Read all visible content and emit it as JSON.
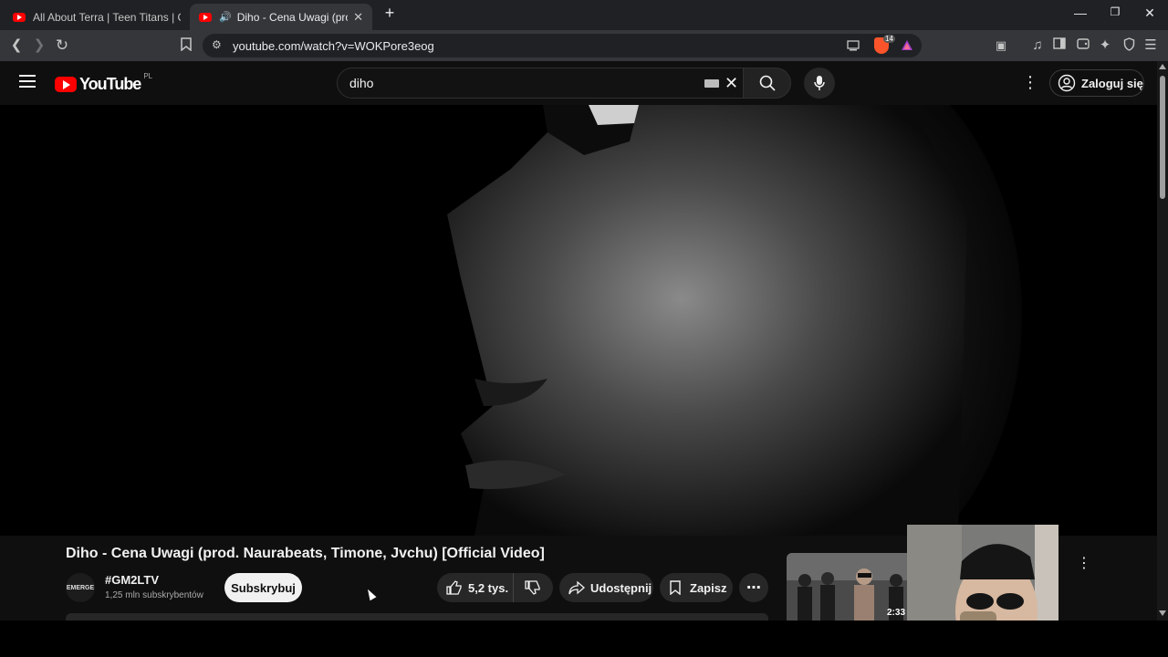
{
  "browser": {
    "tabs": [
      {
        "title": "All About Terra | Teen Titans | Cartoon",
        "active": false
      },
      {
        "title": "Diho - Cena Uwagi (prod. Naurabeats",
        "active": true
      }
    ],
    "url": "youtube.com/watch?v=WOKPore3eog",
    "brave_badge": "14"
  },
  "youtube": {
    "logo_text": "YouTube",
    "region": "PL",
    "search_value": "diho",
    "signin_label": "Zaloguj się"
  },
  "video": {
    "title": "Diho - Cena Uwagi (prod. Naurabeats, Timone, Jvchu) [Official Video]",
    "channel_name": "#GM2LTV",
    "channel_avatar_text": "EMERGE",
    "subscribers": "1,25 mln subskrybentów",
    "subscribe_label": "Subskrybuj",
    "likes": "5,2 tys.",
    "share_label": "Udostępnij",
    "save_label": "Zapisz"
  },
  "recommended": {
    "duration": "2:33"
  },
  "colors": {
    "accent_red": "#ff0000",
    "background": "#0f0f0f",
    "pill": "#272727"
  }
}
